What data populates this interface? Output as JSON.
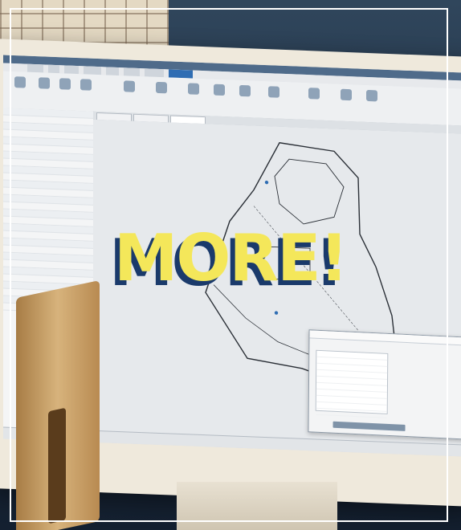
{
  "headline": {
    "text": "MORE!"
  },
  "colors": {
    "headline_fill": "#f4e75a",
    "headline_shadow": "#1a3a6b",
    "frame": "#ffffff",
    "ui_accent": "#2f6db3"
  },
  "scene": {
    "description_icons": [
      "window-grid-icon",
      "floor-plan-icon",
      "chair-icon",
      "power-button-icon"
    ]
  }
}
